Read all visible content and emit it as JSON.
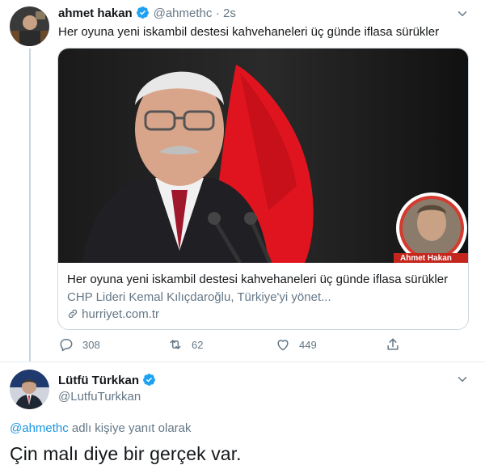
{
  "tweet": {
    "author_name": "ahmet hakan",
    "author_handle": "@ahmethc",
    "time": "2s",
    "text": "Her oyuna yeni iskambil destesi kahvehaneleri üç günde iflasa sürükler",
    "card": {
      "title": "Her oyuna yeni iskambil destesi kahvehaneleri üç günde iflasa sürükler",
      "description": "CHP Lideri Kemal Kılıçdaroğlu, Türkiye'yi yönet...",
      "link": "hurriyet.com.tr",
      "image_caption": "Ahmet Hakan"
    },
    "actions": {
      "reply_count": "308",
      "retweet_count": "62",
      "like_count": "449"
    }
  },
  "reply": {
    "author_name": "Lütfü Türkkan",
    "author_handle": "@LutfuTurkkan",
    "reply_to_handle": "@ahmethc",
    "reply_to_suffix": " adlı kişiye yanıt olarak",
    "text": "Çin malı diye bir gerçek var."
  },
  "colors": {
    "verified": "#1da1f2",
    "link": "#1b95e0",
    "secondary": "#657786"
  },
  "icons": [
    "verified-badge-icon",
    "chevron-down-icon",
    "link-icon",
    "reply-icon",
    "retweet-icon",
    "like-icon",
    "share-icon"
  ]
}
